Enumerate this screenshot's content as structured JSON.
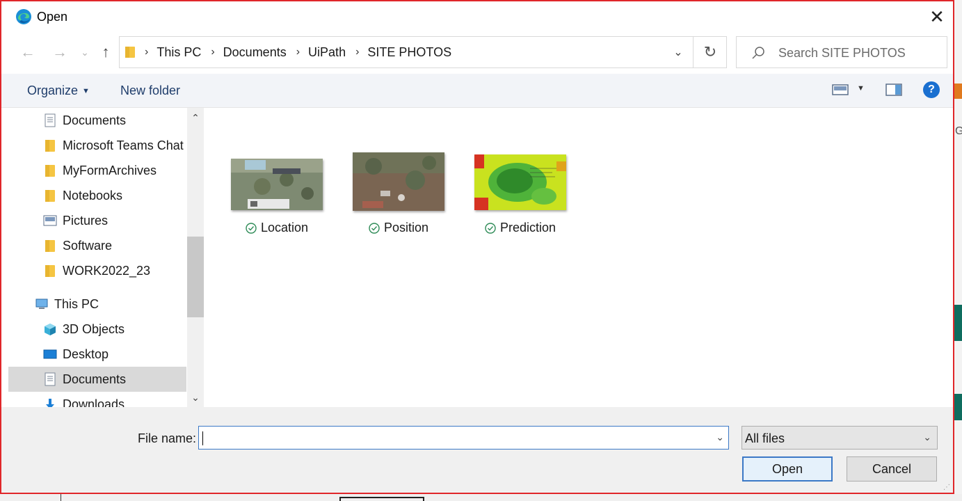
{
  "window": {
    "title": "Open",
    "close_glyph": "✕"
  },
  "nav_buttons": {
    "back": "←",
    "forward": "→",
    "recent": "⌄",
    "up": "↑"
  },
  "breadcrumb": [
    "This PC",
    "Documents",
    "UiPath",
    "SITE PHOTOS"
  ],
  "search": {
    "placeholder": "Search SITE PHOTOS"
  },
  "toolbar": {
    "organize": "Organize",
    "new_folder": "New folder",
    "help": "?"
  },
  "nav_pane": {
    "items": [
      {
        "label": "Documents",
        "icon": "documents-icon"
      },
      {
        "label": "Microsoft Teams Chat Files",
        "icon": "folder-icon"
      },
      {
        "label": "MyFormArchives",
        "icon": "folder-icon"
      },
      {
        "label": "Notebooks",
        "icon": "folder-icon"
      },
      {
        "label": "Pictures",
        "icon": "pictures-icon"
      },
      {
        "label": "Software",
        "icon": "folder-icon"
      },
      {
        "label": "WORK2022_23",
        "icon": "folder-icon"
      },
      {
        "label": "This PC",
        "icon": "computer-icon"
      },
      {
        "label": "3D Objects",
        "icon": "cube-icon"
      },
      {
        "label": "Desktop",
        "icon": "desktop-icon"
      },
      {
        "label": "Documents",
        "icon": "documents-icon",
        "selected": true
      },
      {
        "label": "Downloads",
        "icon": "download-icon"
      }
    ]
  },
  "files": [
    {
      "name": "Location",
      "status": "synced"
    },
    {
      "name": "Position",
      "status": "synced"
    },
    {
      "name": "Prediction",
      "status": "synced"
    }
  ],
  "bottom": {
    "file_name_label": "File name:",
    "file_name_value": "",
    "filter": "All files",
    "open": "Open",
    "cancel": "Cancel"
  },
  "colors": {
    "accent": "#3b78c6",
    "help": "#1a6fd0",
    "dialog_border": "#e0262a"
  }
}
